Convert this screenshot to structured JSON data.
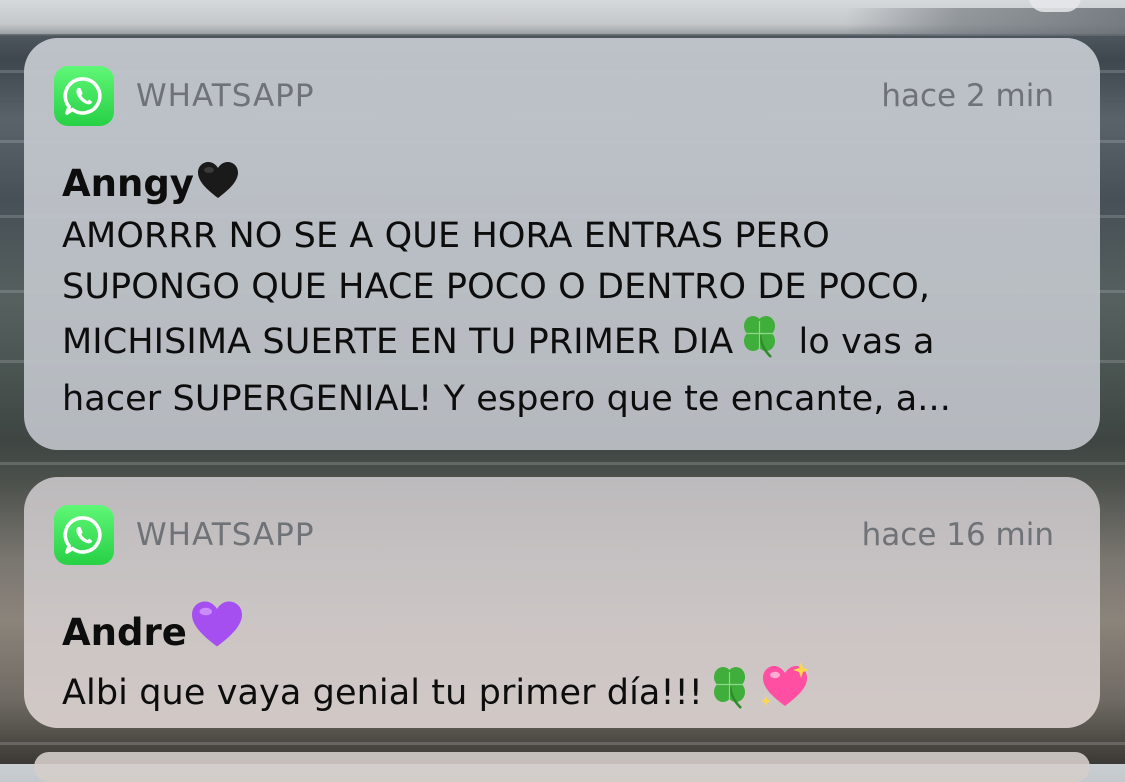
{
  "notifications": [
    {
      "app_name": "WHATSAPP",
      "app_icon": "whatsapp-icon",
      "timestamp": "hace 2 min",
      "sender": "Anngy",
      "sender_emoji": "black-heart-icon",
      "body_lines": [
        "AMORRR NO SE A QUE HORA ENTRAS PERO",
        "SUPONGO QUE HACE POCO O DENTRO DE POCO,",
        "MICHISIMA SUERTE EN TU PRIMER DIA",
        " lo vas a",
        "hacer SUPERGENIAL! Y espero que te encante, a..."
      ]
    },
    {
      "app_name": "WHATSAPP",
      "app_icon": "whatsapp-icon",
      "timestamp": "hace 16 min",
      "sender": "Andre",
      "sender_emoji": "purple-heart-icon",
      "body": "Albi que vaya genial tu primer día!!!"
    }
  ],
  "colors": {
    "whatsapp_green": "#2bd14a",
    "secondary_text": "#6f7276",
    "black_heart": "#1a1a1a",
    "purple_heart": "#a64ff0",
    "clover_green": "#3fae3a",
    "sparkle_heart_pink": "#ff4fa3"
  }
}
